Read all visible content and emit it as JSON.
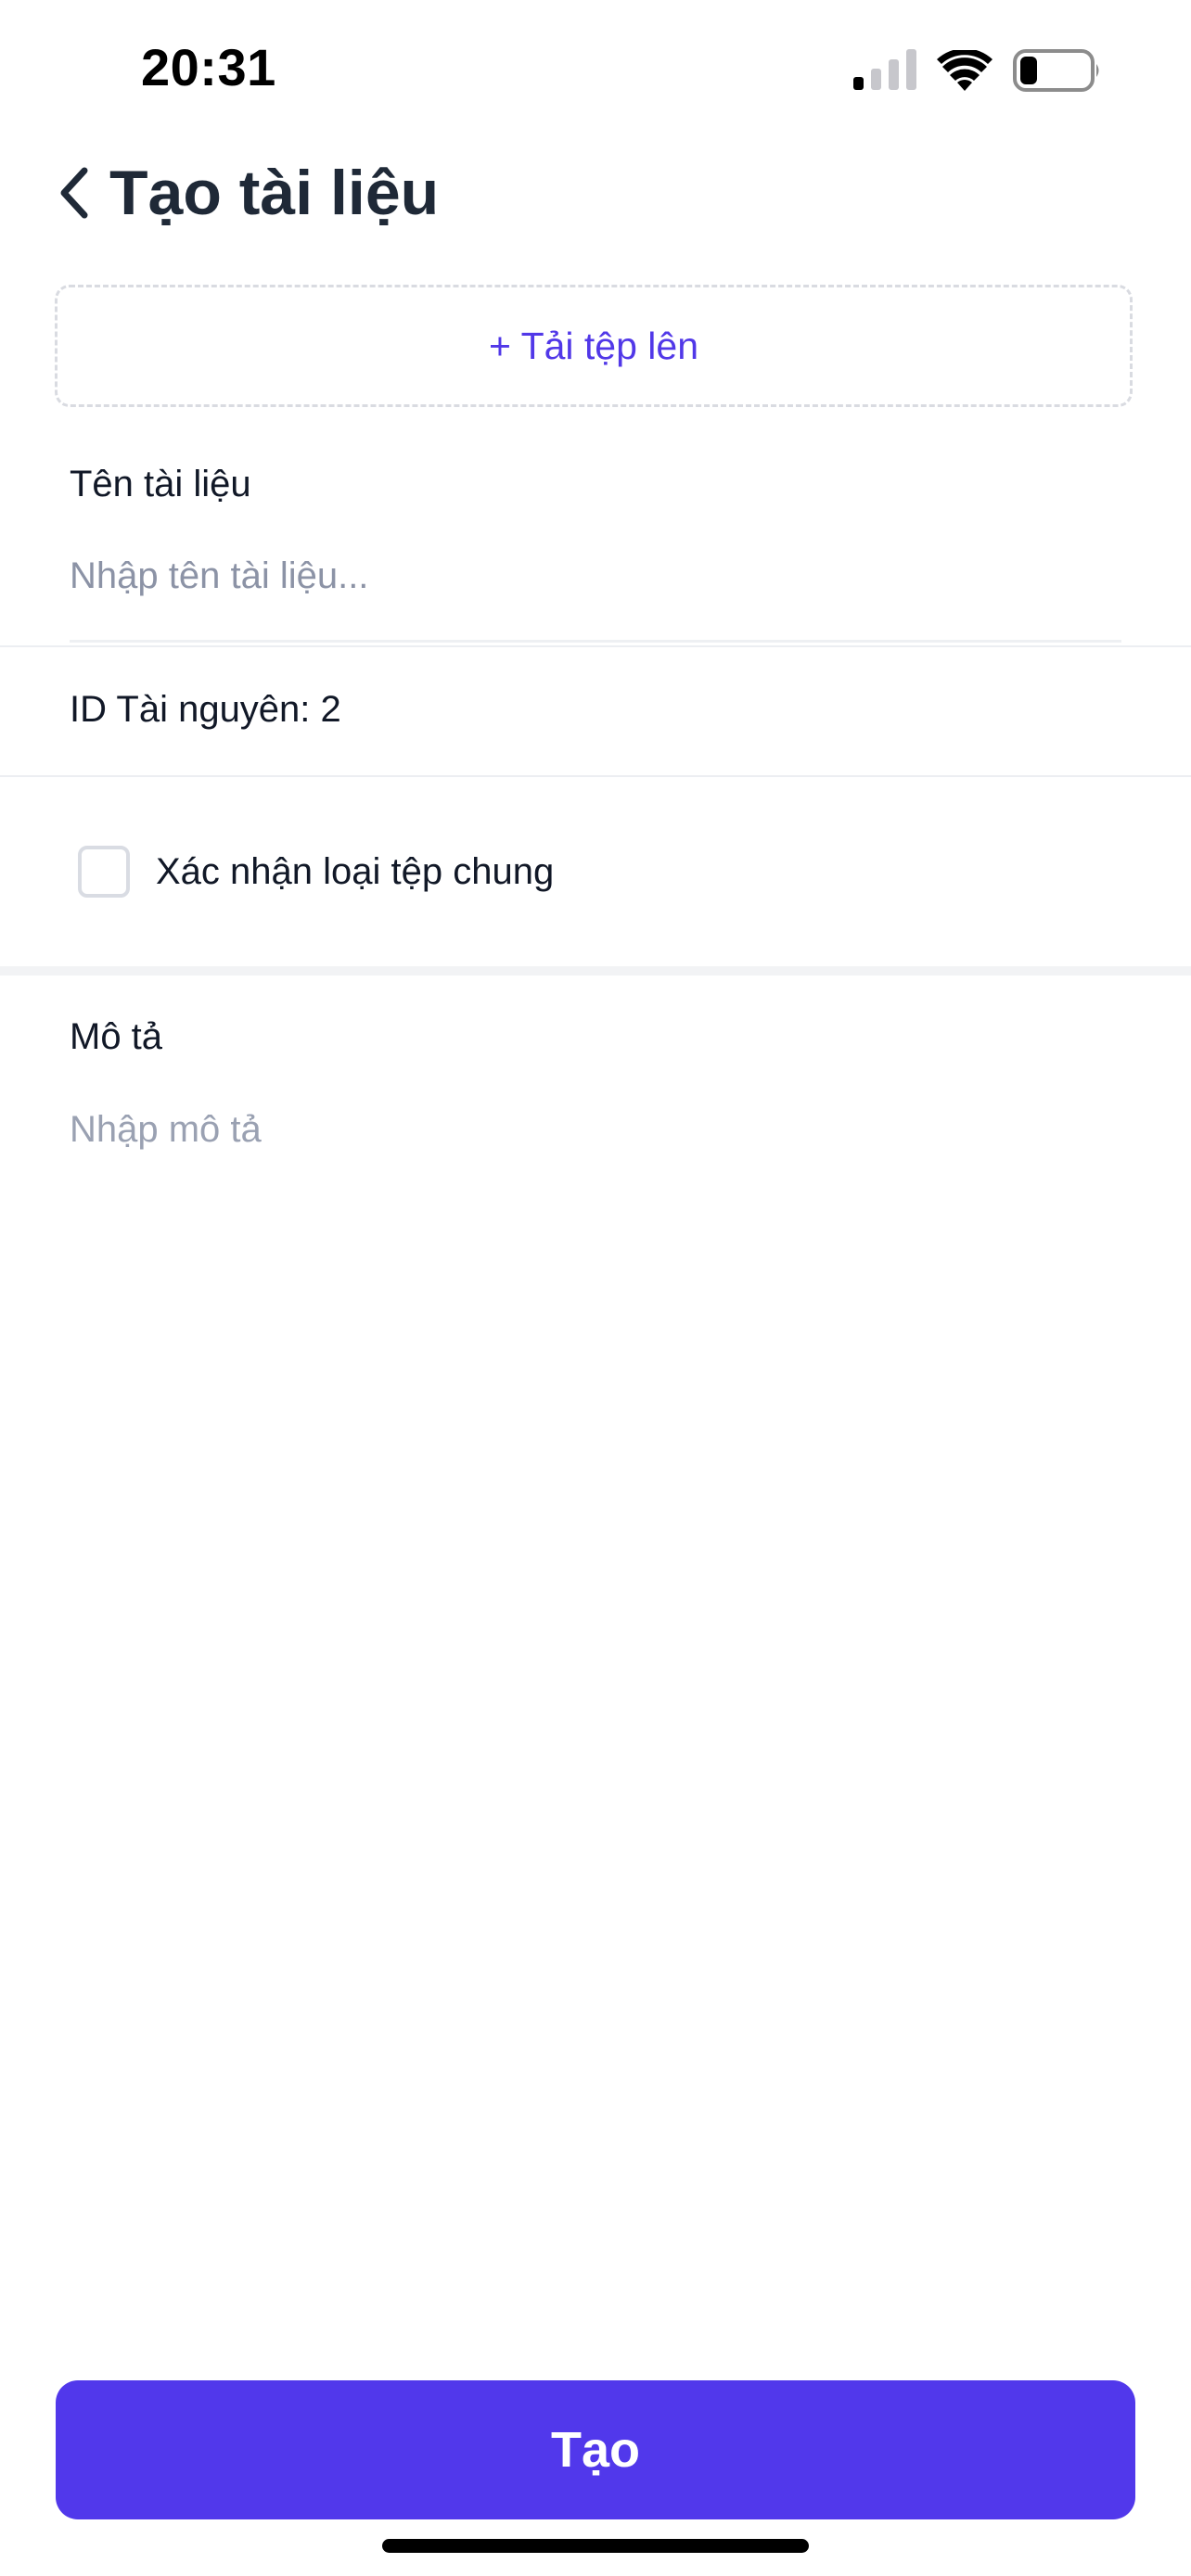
{
  "status_bar": {
    "time": "20:31",
    "icons": [
      "cellular-signal-icon",
      "wifi-icon",
      "battery-icon"
    ]
  },
  "header": {
    "back_icon": "chevron-left-icon",
    "title": "Tạo tài liệu"
  },
  "upload": {
    "label": "+ Tải tệp lên"
  },
  "form": {
    "name_label": "Tên tài liệu",
    "name_placeholder": "Nhập tên tài liệu...",
    "name_value": "",
    "resource_id_text": "ID Tài nguyên: 2",
    "checkbox_label": "Xác nhận loại tệp chung",
    "checkbox_checked": false,
    "description_label": "Mô tả",
    "description_placeholder": "Nhập mô tả",
    "description_value": ""
  },
  "submit": {
    "label": "Tạo"
  },
  "colors": {
    "accent": "#5138eb",
    "title_text": "#1f2937",
    "placeholder": "#8c93a6",
    "divider": "#eceef2"
  }
}
